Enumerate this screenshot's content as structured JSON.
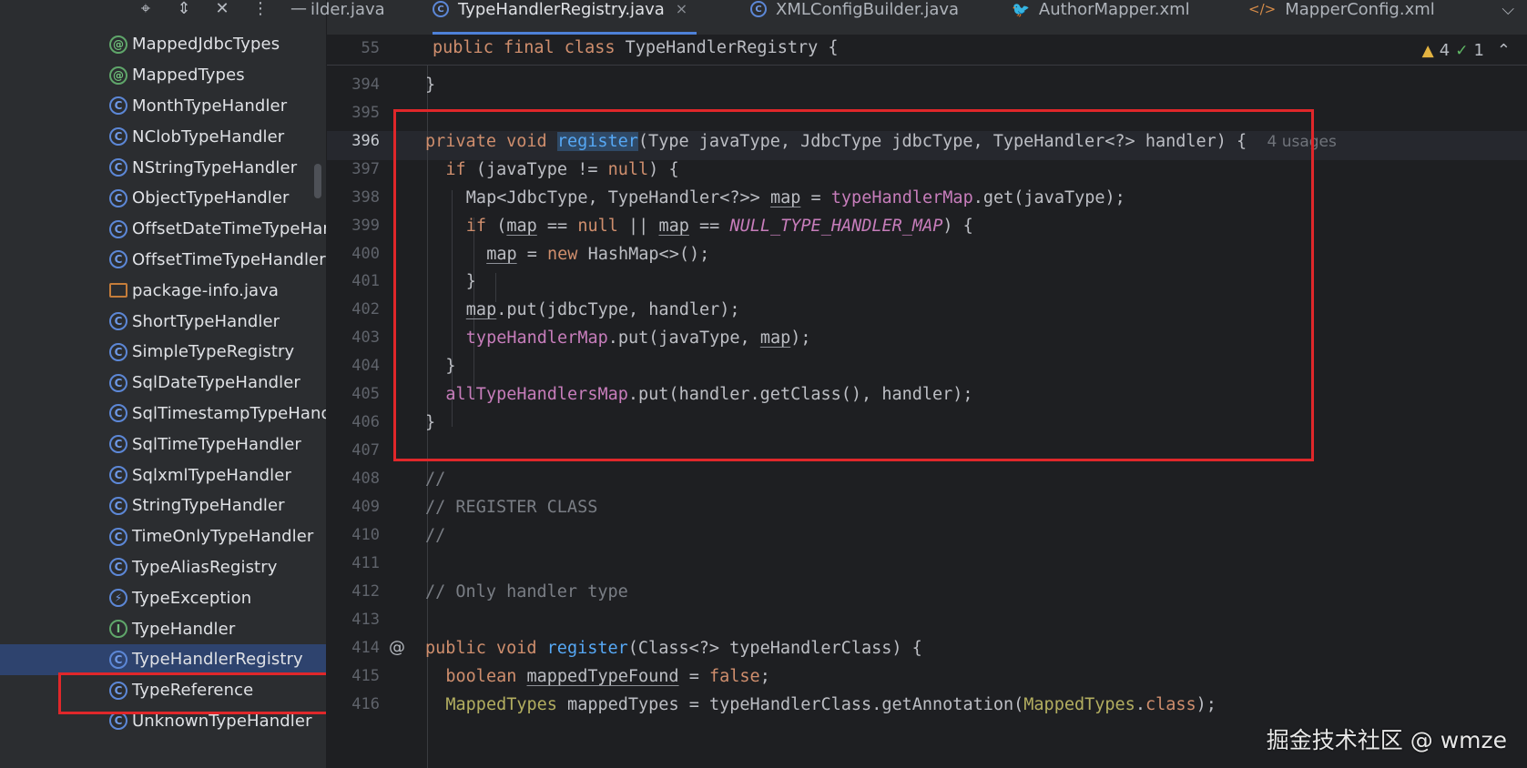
{
  "tree": {
    "toolbar_icons": [
      "target-icon",
      "expand-collapse-icon",
      "collapse-all-icon",
      "more-icon",
      "minimize-icon"
    ],
    "items": [
      {
        "label": "MappedJdbcTypes",
        "icon": "annotation"
      },
      {
        "label": "MappedTypes",
        "icon": "annotation"
      },
      {
        "label": "MonthTypeHandler",
        "icon": "class"
      },
      {
        "label": "NClobTypeHandler",
        "icon": "class"
      },
      {
        "label": "NStringTypeHandler",
        "icon": "class"
      },
      {
        "label": "ObjectTypeHandler",
        "icon": "class"
      },
      {
        "label": "OffsetDateTimeTypeHan",
        "icon": "class"
      },
      {
        "label": "OffsetTimeTypeHandler",
        "icon": "class"
      },
      {
        "label": "package-info.java",
        "icon": "java-file"
      },
      {
        "label": "ShortTypeHandler",
        "icon": "class"
      },
      {
        "label": "SimpleTypeRegistry",
        "icon": "class"
      },
      {
        "label": "SqlDateTypeHandler",
        "icon": "class"
      },
      {
        "label": "SqlTimestampTypeHand",
        "icon": "class"
      },
      {
        "label": "SqlTimeTypeHandler",
        "icon": "class"
      },
      {
        "label": "SqlxmlTypeHandler",
        "icon": "class"
      },
      {
        "label": "StringTypeHandler",
        "icon": "class"
      },
      {
        "label": "TimeOnlyTypeHandler",
        "icon": "class"
      },
      {
        "label": "TypeAliasRegistry",
        "icon": "class"
      },
      {
        "label": "TypeException",
        "icon": "exception"
      },
      {
        "label": "TypeHandler",
        "icon": "interface"
      },
      {
        "label": "TypeHandlerRegistry",
        "icon": "class",
        "selected": true
      },
      {
        "label": "TypeReference",
        "icon": "class"
      },
      {
        "label": "UnknownTypeHandler",
        "icon": "class"
      }
    ]
  },
  "tabs": [
    {
      "label": "ilder.java",
      "icon": "none"
    },
    {
      "label": "TypeHandlerRegistry.java",
      "icon": "class",
      "active": true,
      "close": "×"
    },
    {
      "label": "XMLConfigBuilder.java",
      "icon": "class"
    },
    {
      "label": "AuthorMapper.xml",
      "icon": "mapper"
    },
    {
      "label": "MapperConfig.xml",
      "icon": "xml"
    }
  ],
  "tab_dropdown": "⌵",
  "inspections": {
    "warnings": "4",
    "ok": "1"
  },
  "sticky": {
    "line": "55",
    "code": "public final class TypeHandlerRegistry {"
  },
  "lines": [
    {
      "n": "394",
      "code": "}"
    },
    {
      "n": "395",
      "code": ""
    },
    {
      "n": "396",
      "code": "private void register(Type javaType, JdbcType jdbcType, TypeHandler<?> handler) {",
      "hint": "4 usages"
    },
    {
      "n": "397",
      "code": "if (javaType != null) {"
    },
    {
      "n": "398",
      "code": "Map<JdbcType, TypeHandler<?>> map = typeHandlerMap.get(javaType);"
    },
    {
      "n": "399",
      "code": "if (map == null || map == NULL_TYPE_HANDLER_MAP) {"
    },
    {
      "n": "400",
      "code": "map = new HashMap<>();"
    },
    {
      "n": "401",
      "code": "}"
    },
    {
      "n": "402",
      "code": "map.put(jdbcType, handler);"
    },
    {
      "n": "403",
      "code": "typeHandlerMap.put(javaType, map);"
    },
    {
      "n": "404",
      "code": "}"
    },
    {
      "n": "405",
      "code": "allTypeHandlersMap.put(handler.getClass(), handler);"
    },
    {
      "n": "406",
      "code": "}"
    },
    {
      "n": "407",
      "code": ""
    },
    {
      "n": "408",
      "code": "//"
    },
    {
      "n": "409",
      "code": "// REGISTER CLASS"
    },
    {
      "n": "410",
      "code": "//"
    },
    {
      "n": "411",
      "code": ""
    },
    {
      "n": "412",
      "code": "// Only handler type"
    },
    {
      "n": "413",
      "code": ""
    },
    {
      "n": "414",
      "code": "public void register(Class<?> typeHandlerClass) {"
    },
    {
      "n": "415",
      "code": "boolean mappedTypeFound = false;"
    },
    {
      "n": "416",
      "code": "MappedTypes mappedTypes = typeHandlerClass.getAnnotation(MappedTypes.class);"
    }
  ],
  "gutter_marker": "@",
  "watermark": "掘金技术社区 @ wmze",
  "colors": {
    "keyword": "#cf8e6d",
    "function": "#56a8f5",
    "field": "#c77dbb",
    "comment": "#7a7e85",
    "annotation": "#b3ae60",
    "highlight_box": "#e0272a"
  }
}
